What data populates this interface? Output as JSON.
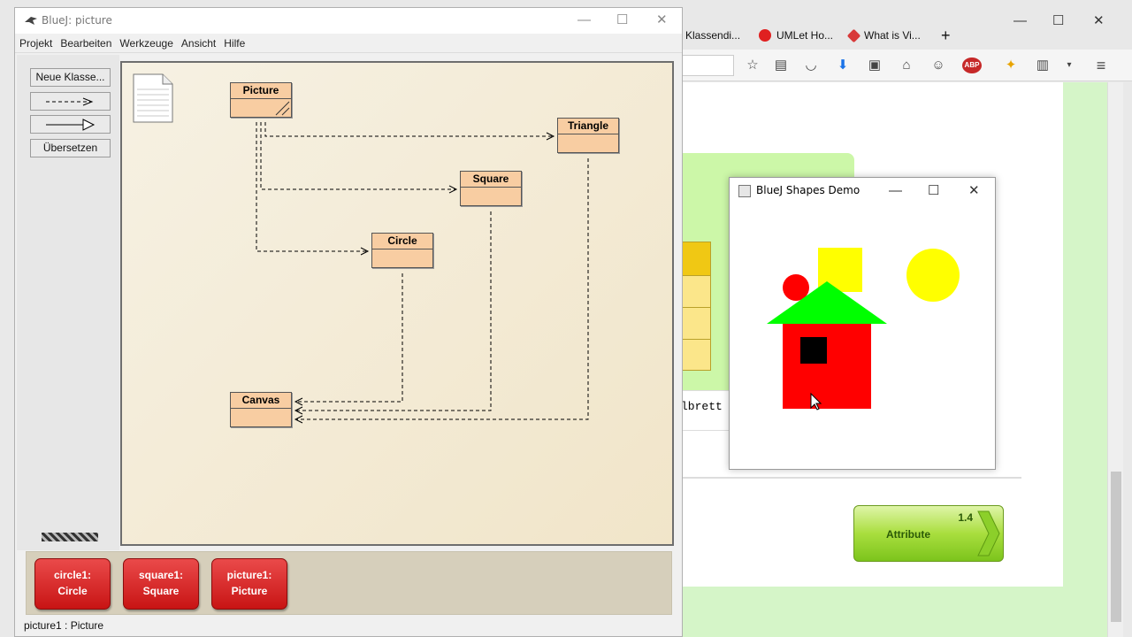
{
  "browser": {
    "tabs": [
      {
        "label": "Klassendi...",
        "favicon": "page-icon"
      },
      {
        "label": "UMLet Ho...",
        "favicon": "umlet-icon"
      },
      {
        "label": "What is Vi...",
        "favicon": "diamond-icon"
      }
    ],
    "new_tab_label": "+",
    "code_fragment": "lbrett",
    "attribute_button": {
      "number": "1.4",
      "label": "Attribute"
    }
  },
  "shapes_window": {
    "title": "BlueJ Shapes Demo",
    "colors": {
      "yellow": "#ffff00",
      "red": "#ff0000",
      "green": "#00ff00",
      "black": "#000000"
    }
  },
  "bluej": {
    "title": "BlueJ:  picture",
    "menu": [
      "Projekt",
      "Bearbeiten",
      "Werkzeuge",
      "Ansicht",
      "Hilfe"
    ],
    "tools": {
      "new_class": "Neue Klasse...",
      "compile": "Übersetzen"
    },
    "classes": {
      "picture": "Picture",
      "triangle": "Triangle",
      "square": "Square",
      "circle": "Circle",
      "canvas": "Canvas"
    },
    "objects": [
      {
        "name": "circle1:",
        "type": "Circle"
      },
      {
        "name": "square1:",
        "type": "Square"
      },
      {
        "name": "picture1:",
        "type": "Picture"
      }
    ],
    "status": "picture1 : Picture"
  }
}
